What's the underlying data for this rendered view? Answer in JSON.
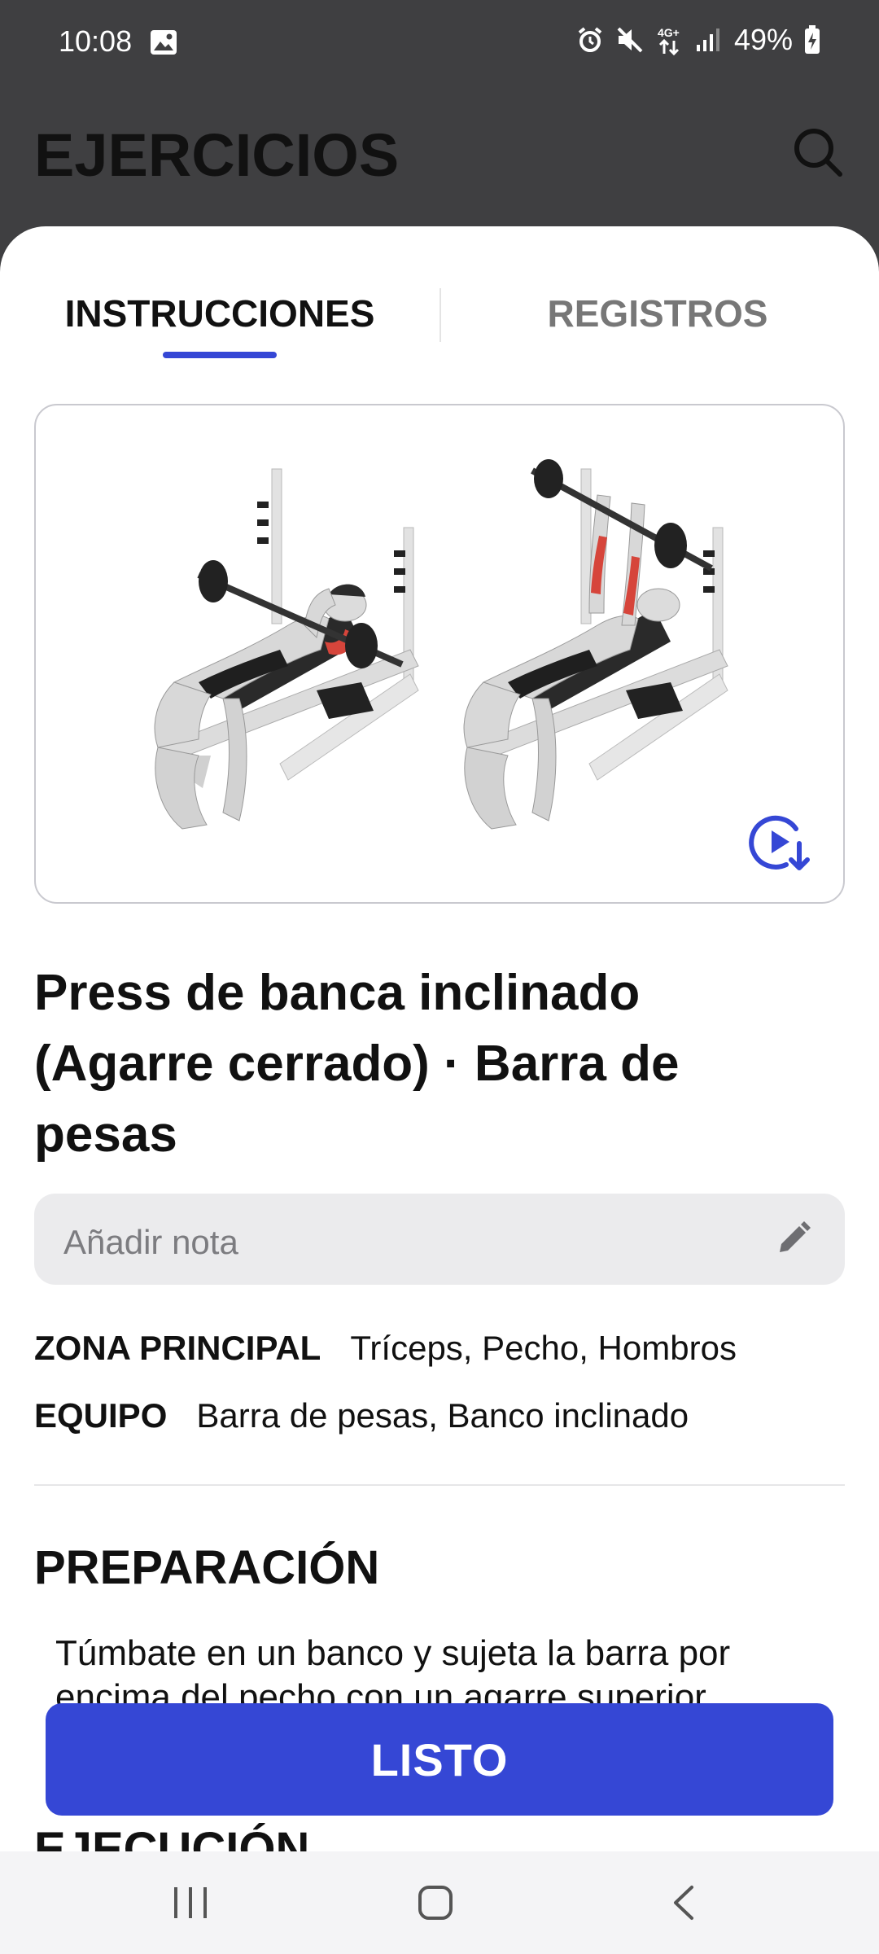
{
  "status_bar": {
    "time": "10:08",
    "battery": "49%",
    "network": "4G+"
  },
  "header": {
    "title": "EJERCICIOS",
    "search_icon": "search-icon"
  },
  "tabs": [
    {
      "label": "INSTRUCCIONES",
      "active": true
    },
    {
      "label": "REGISTROS",
      "active": false
    }
  ],
  "exercise": {
    "title_line1": "Press de banca inclinado",
    "title_line2": "(Agarre cerrado) · Barra de",
    "title_line3": "pesas",
    "note_placeholder": "Añadir nota",
    "zone_label": "ZONA PRINCIPAL",
    "zone_value": "Tríceps, Pecho, Hombros",
    "equipment_label": "EQUIPO",
    "equipment_value": "Barra de pesas, Banco inclinado"
  },
  "sections": {
    "preparation_title": "PREPARACIÓN",
    "preparation_text": "Túmbate en un banco y sujeta la barra por encima del pecho con un agarre superior",
    "execution_title": "EJECUCIÓN"
  },
  "actions": {
    "done_label": "LISTO"
  },
  "colors": {
    "accent": "#3547d5",
    "header_bg": "#3f3f41",
    "muscle_highlight": "#d6453b"
  }
}
